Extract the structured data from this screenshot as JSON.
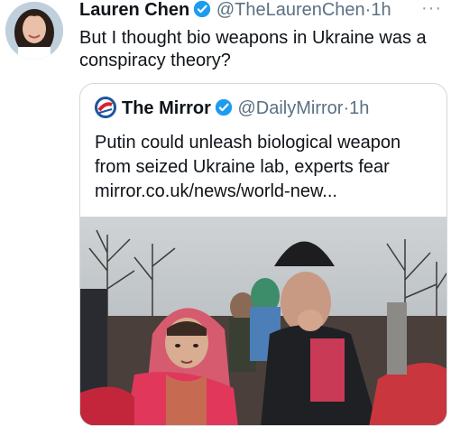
{
  "tweet": {
    "author_name": "Lauren Chen",
    "author_handle": "@TheLaurenChen",
    "separator": "·",
    "time": "1h",
    "more_icon": "more-horizontal-icon",
    "text": "But I thought bio weapons in Ukraine was a conspiracy theory?"
  },
  "quote": {
    "author_name": "The Mirror",
    "author_handle": "@DailyMirror",
    "separator": "·",
    "time": "1h",
    "text": "Putin could unleash biological weapon from seized Ukraine lab, experts fear",
    "link": "mirror.co.uk/news/world-new..."
  },
  "colors": {
    "verified": "#1d9bf0",
    "secondary_text": "#5b7083",
    "border": "#cfd9de",
    "brand_mirror": "#1e56a0"
  }
}
